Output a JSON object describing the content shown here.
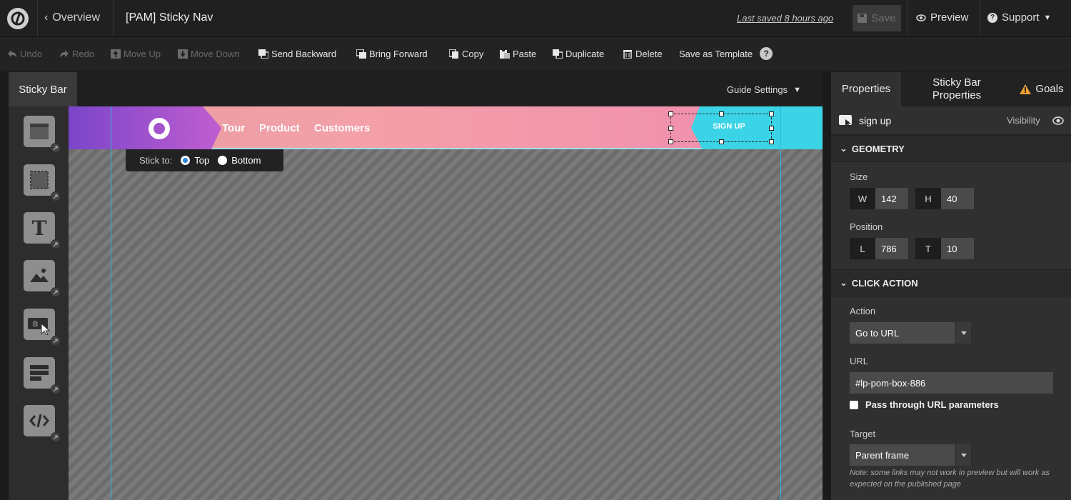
{
  "topbar": {
    "back_label": "Overview",
    "title": "[PAM] Sticky Nav",
    "last_saved": "Last saved  8 hours ago",
    "save_label": "Save",
    "preview_label": "Preview",
    "support_label": "Support"
  },
  "toolbar": {
    "undo": "Undo",
    "redo": "Redo",
    "move_up": "Move Up",
    "move_down": "Move Down",
    "send_backward": "Send Backward",
    "bring_forward": "Bring Forward",
    "copy": "Copy",
    "paste": "Paste",
    "duplicate": "Duplicate",
    "delete": "Delete",
    "save_template": "Save as Template",
    "help": "?"
  },
  "canvas": {
    "tab_label": "Sticky Bar",
    "guide_settings": "Guide Settings",
    "tools": [
      "section-icon",
      "box-icon",
      "text-icon",
      "image-icon",
      "button-icon",
      "form-icon",
      "code-icon"
    ],
    "nav_links": [
      "Tour",
      "Product",
      "Customers"
    ],
    "signup_label": "SIGN UP",
    "stick_to_label": "Stick to:",
    "stick_top": "Top",
    "stick_bottom": "Bottom",
    "stick_selected": "Top"
  },
  "panel": {
    "tabs": {
      "properties": "Properties",
      "sticky_props": "Sticky Bar Properties",
      "goals": "Goals"
    },
    "element_name": "sign up",
    "visibility": "Visibility",
    "geometry": {
      "header": "GEOMETRY",
      "size_label": "Size",
      "w_key": "W",
      "w_val": "142",
      "h_key": "H",
      "h_val": "40",
      "position_label": "Position",
      "l_key": "L",
      "l_val": "786",
      "t_key": "T",
      "t_val": "10"
    },
    "click_action": {
      "header": "CLICK ACTION",
      "action_label": "Action",
      "action_value": "Go to URL",
      "url_label": "URL",
      "url_value": "#lp-pom-box-886",
      "pass_through": "Pass through URL parameters",
      "pass_through_checked": false,
      "target_label": "Target",
      "target_value": "Parent frame",
      "note": "Note: some links may not work in preview but will work as expected on the published page"
    }
  },
  "colors": {
    "accent": "#2fb4e0",
    "warning": "#f0a030",
    "purple": "#7b45c9",
    "cyan": "#3ad4e6",
    "pink": "#f4a0a8"
  }
}
